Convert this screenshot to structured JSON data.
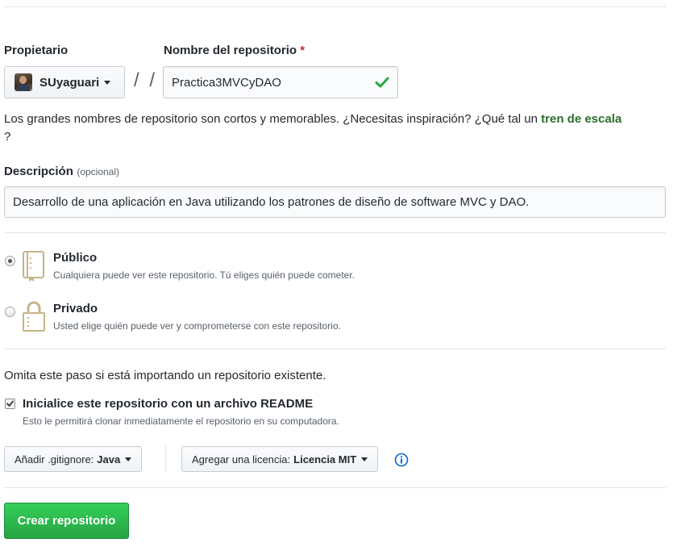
{
  "owner": {
    "label": "Propietario",
    "name": "SUyaguari"
  },
  "separator": "/ /",
  "repository": {
    "label": "Nombre del repositorio",
    "required_mark": "*",
    "value": "Practica3MVCyDAO"
  },
  "hint": {
    "text": "Los grandes nombres de repositorio son cortos y memorables. ¿Necesitas inspiración? ¿Qué tal un ",
    "suggestion": "tren de escala",
    "end": "?"
  },
  "description": {
    "label": "Descripción",
    "optional": "(opcional)",
    "value": "Desarrollo de una aplicación en Java utilizando los patrones de diseño de software MVC y DAO."
  },
  "visibility": {
    "public": {
      "title": "Público",
      "note": "Cualquiera puede ver este repositorio. Tú eliges quién puede cometer.",
      "selected": true
    },
    "private": {
      "title": "Privado",
      "note": "Usted elige quién puede ver y comprometerse con este repositorio.",
      "selected": false
    }
  },
  "init": {
    "skip_text": "Omita este paso si está importando un repositorio existente.",
    "readme_label": "Inicialice este repositorio con un archivo README",
    "readme_note": "Esto le permitirá clonar inmediatamente el repositorio en su computadora.",
    "readme_checked": true
  },
  "gitignore": {
    "label": "Añadir .gitignore:",
    "value": "Java"
  },
  "license": {
    "label": "Agregar una licencia:",
    "value": "Licencia MIT"
  },
  "submit_label": "Crear repositorio",
  "colors": {
    "accent_green": "#28a745",
    "check_green": "#28a745",
    "info_blue": "#0366d6",
    "required_red": "#cb2431",
    "icon_tan": "#c8b48a"
  }
}
